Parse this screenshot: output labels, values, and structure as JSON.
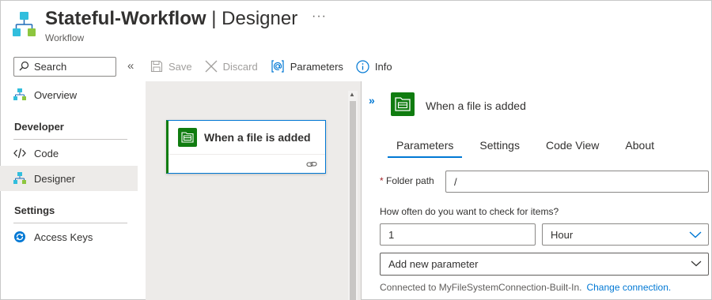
{
  "header": {
    "title_bold": "Stateful-Workflow",
    "title_sep": "|",
    "title_rest": "Designer",
    "more": "···",
    "subtitle": "Workflow"
  },
  "sidebar": {
    "search_label": "Search",
    "collapse": "«",
    "items": [
      {
        "label": "Overview",
        "icon": "workflow-icon"
      },
      {
        "label": "Code",
        "icon": "code-icon"
      },
      {
        "label": "Designer",
        "icon": "designer-icon",
        "active": true
      },
      {
        "label": "Access Keys",
        "icon": "access-keys-icon"
      }
    ],
    "sections": {
      "developer": "Developer",
      "settings": "Settings"
    }
  },
  "toolbar": {
    "save": "Save",
    "discard": "Discard",
    "parameters": "Parameters",
    "info": "Info"
  },
  "canvas": {
    "trigger_label": "When a file is added"
  },
  "panel": {
    "expand": "»",
    "title": "When a file is added",
    "tabs": [
      "Parameters",
      "Settings",
      "Code View",
      "About"
    ],
    "selected_tab": "Parameters",
    "folder_path_label": "Folder path",
    "required_mark": "*",
    "folder_path_value": "/",
    "frequency_question": "How often do you want to check for items?",
    "interval_value": "1",
    "frequency_value": "Hour",
    "add_param_placeholder": "Add new parameter",
    "connected_text": "Connected to MyFileSystemConnection-Built-In.",
    "change_connection": "Change connection."
  },
  "colors": {
    "accent": "#0078d4",
    "trigger_green": "#107c10",
    "required_red": "#a4262c"
  }
}
